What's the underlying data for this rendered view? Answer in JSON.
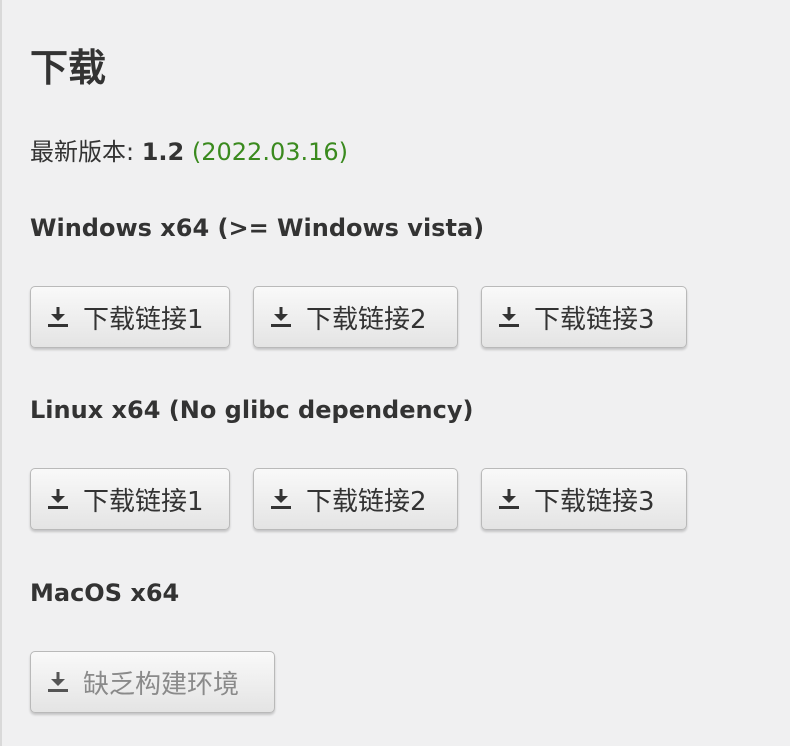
{
  "page": {
    "title": "下载",
    "version_label": "最新版本: ",
    "version_number": "1.2",
    "version_date": "(2022.03.16)"
  },
  "sections": [
    {
      "heading": "Windows x64 (>= Windows vista)",
      "buttons": [
        {
          "label": "下载链接1",
          "icon": "download-icon",
          "enabled": true
        },
        {
          "label": "下载链接2",
          "icon": "download-icon",
          "enabled": true
        },
        {
          "label": "下载链接3",
          "icon": "download-icon",
          "enabled": true
        }
      ]
    },
    {
      "heading": "Linux x64 (No glibc dependency)",
      "buttons": [
        {
          "label": "下载链接1",
          "icon": "download-icon",
          "enabled": true
        },
        {
          "label": "下载链接2",
          "icon": "download-icon",
          "enabled": true
        },
        {
          "label": "下载链接3",
          "icon": "download-icon",
          "enabled": true
        }
      ]
    },
    {
      "heading": "MacOS x64",
      "buttons": [
        {
          "label": "缺乏构建环境",
          "icon": "download-icon",
          "enabled": false
        }
      ]
    }
  ],
  "colors": {
    "background": "#f0f0f1",
    "text": "#333333",
    "date_green": "#3a8a1e",
    "disabled_text": "#8a8a8a"
  }
}
